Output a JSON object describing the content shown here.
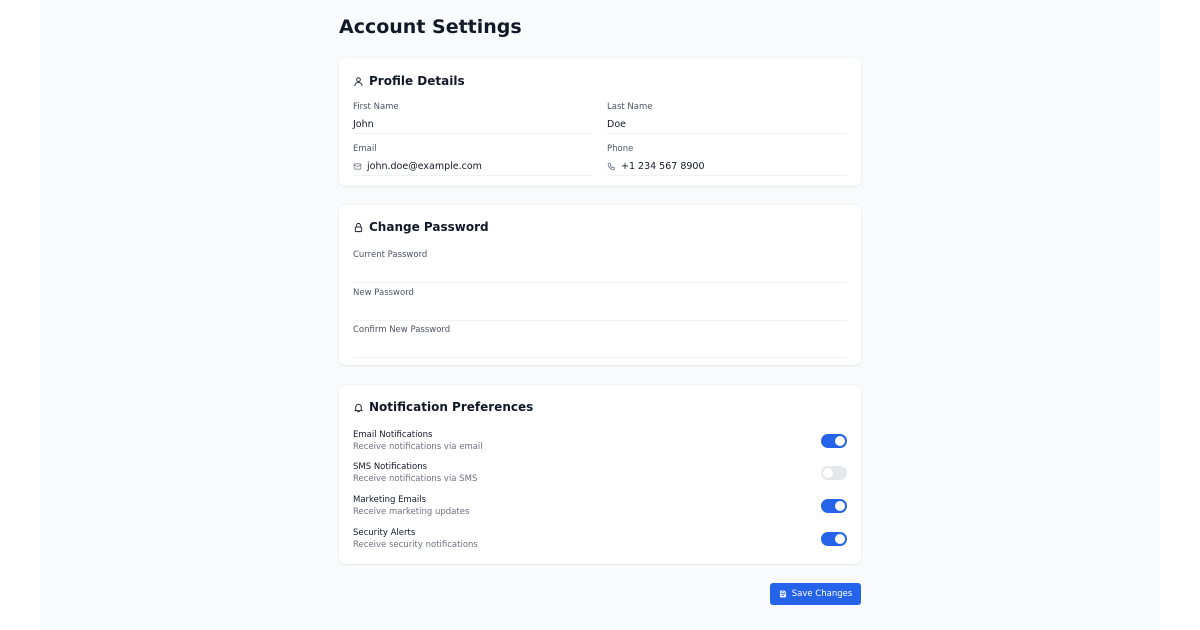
{
  "page": {
    "title": "Account Settings"
  },
  "profile": {
    "title": "Profile Details",
    "icon": "user-icon",
    "first_name_label": "First Name",
    "first_name_value": "John",
    "last_name_label": "Last Name",
    "last_name_value": "Doe",
    "email_label": "Email",
    "email_value": "john.doe@example.com",
    "email_icon": "mail-icon",
    "phone_label": "Phone",
    "phone_value": "+1 234 567 8900",
    "phone_icon": "phone-icon"
  },
  "password": {
    "title": "Change Password",
    "icon": "lock-icon",
    "current_label": "Current Password",
    "new_label": "New Password",
    "confirm_label": "Confirm New Password"
  },
  "notifications": {
    "title": "Notification Preferences",
    "icon": "bell-icon",
    "items": [
      {
        "title": "Email Notifications",
        "description": "Receive notifications via email",
        "enabled": true
      },
      {
        "title": "SMS Notifications",
        "description": "Receive notifications via SMS",
        "enabled": false
      },
      {
        "title": "Marketing Emails",
        "description": "Receive marketing updates",
        "enabled": true
      },
      {
        "title": "Security Alerts",
        "description": "Receive security notifications",
        "enabled": true
      }
    ]
  },
  "actions": {
    "save_label": "Save Changes",
    "save_icon": "save-icon"
  },
  "colors": {
    "accent": "#2563eb",
    "toggle_off": "#e5e7eb",
    "background": "#f9fafb"
  }
}
